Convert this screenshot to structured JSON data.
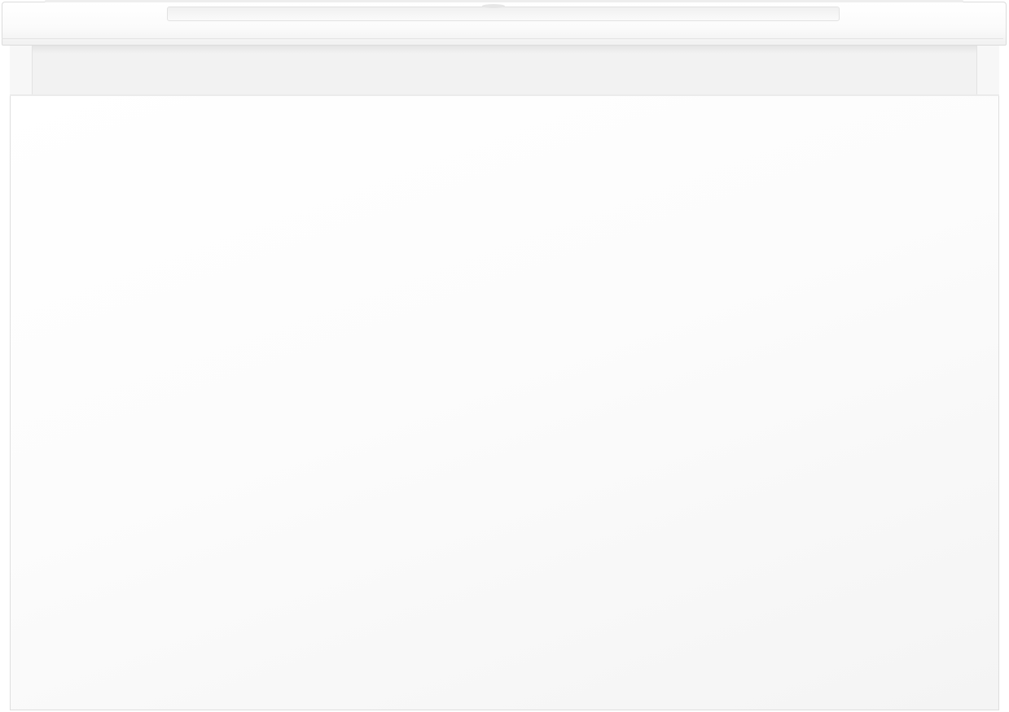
{
  "scene": {
    "subject": "",
    "colors": {
      "background": "#ffffff",
      "cabinet": "#f7f7f7",
      "edge": "#dedede"
    }
  }
}
